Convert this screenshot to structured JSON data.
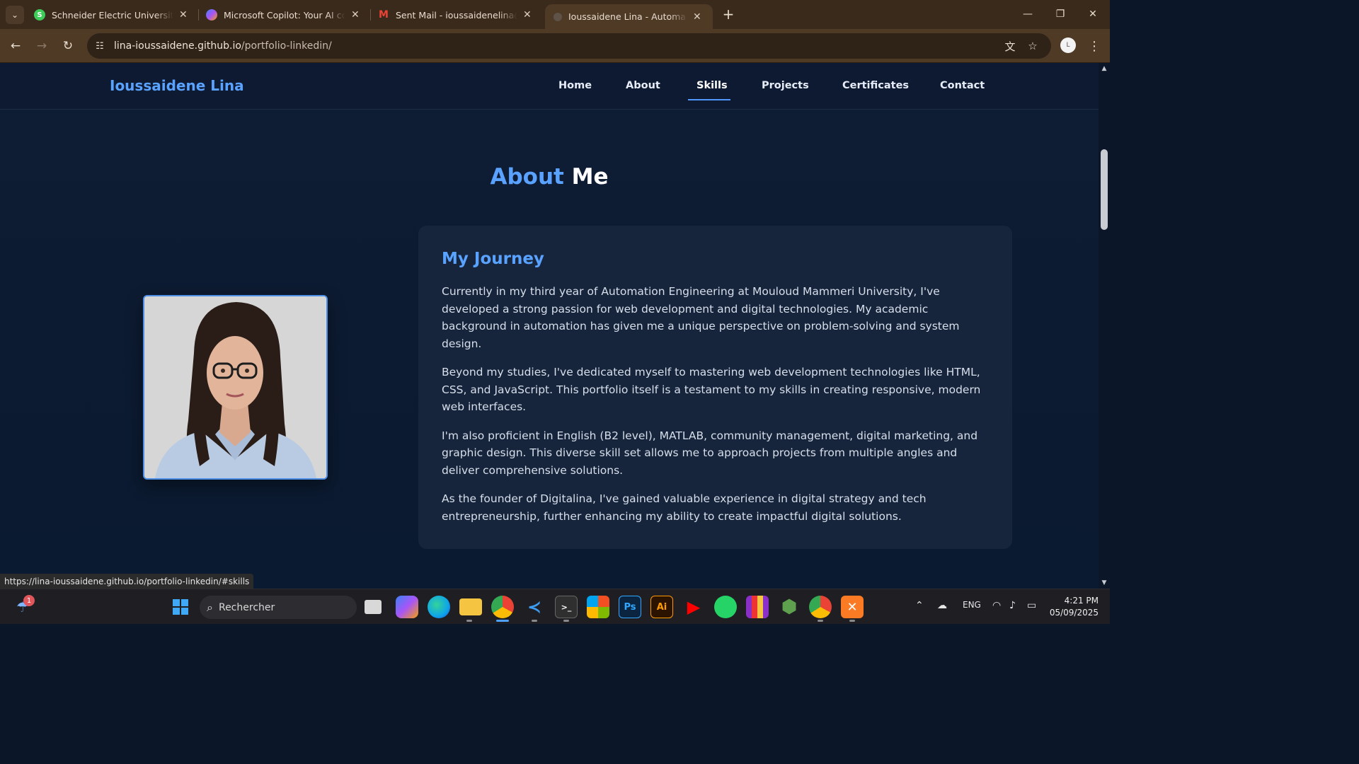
{
  "browser": {
    "tabs": [
      {
        "title": "Schneider Electric University | b",
        "favicon": "schneider-favicon",
        "color": "#3dcd58"
      },
      {
        "title": "Microsoft Copilot: Your AI comp",
        "favicon": "copilot-favicon",
        "color": "#8a5cf6"
      },
      {
        "title": "Sent Mail - ioussaidenelina@gm",
        "favicon": "gmail-favicon",
        "color": "#ea4335"
      },
      {
        "title": "Ioussaidene Lina - Automation E",
        "favicon": "globe-favicon",
        "color": "#9aa0a6"
      }
    ],
    "active_tab_index": 3,
    "url_host": "lina-ioussaidene.github.io",
    "url_path": "/portfolio-linkedin/",
    "status_url": "https://lina-ioussaidene.github.io/portfolio-linkedin/#skills"
  },
  "site": {
    "brand": "Ioussaidene Lina",
    "nav": [
      "Home",
      "About",
      "Skills",
      "Projects",
      "Certificates",
      "Contact"
    ],
    "active_nav": "Skills",
    "accent_color": "#5aa2ff"
  },
  "about": {
    "title_accent": "About",
    "title_rest": "Me",
    "card_title": "My Journey",
    "paragraphs": [
      "Currently in my third year of Automation Engineering at Mouloud Mammeri University, I've developed a strong passion for web development and digital technologies. My academic background in automation has given me a unique perspective on problem-solving and system design.",
      "Beyond my studies, I've dedicated myself to mastering web development technologies like HTML, CSS, and JavaScript. This portfolio itself is a testament to my skills in creating responsive, modern web interfaces.",
      "I'm also proficient in English (B2 level), MATLAB, community management, digital marketing, and graphic design. This diverse skill set allows me to approach projects from multiple angles and deliver comprehensive solutions.",
      "As the founder of Digitalina, I've gained valuable experience in digital strategy and tech entrepreneurship, further enhancing my ability to create impactful digital solutions."
    ]
  },
  "taskbar": {
    "search_placeholder": "Rechercher",
    "weather_badge": "1",
    "language": "ENG",
    "time": "4:21 PM",
    "date": "05/09/2025",
    "apps": [
      "start",
      "search",
      "task-view",
      "copilot",
      "edge",
      "file-explorer",
      "chrome",
      "vscode",
      "terminal",
      "microsoft-store",
      "photoshop",
      "illustrator",
      "youtube",
      "whatsapp",
      "winrar",
      "nodejs",
      "chrome-alt",
      "xampp"
    ]
  }
}
